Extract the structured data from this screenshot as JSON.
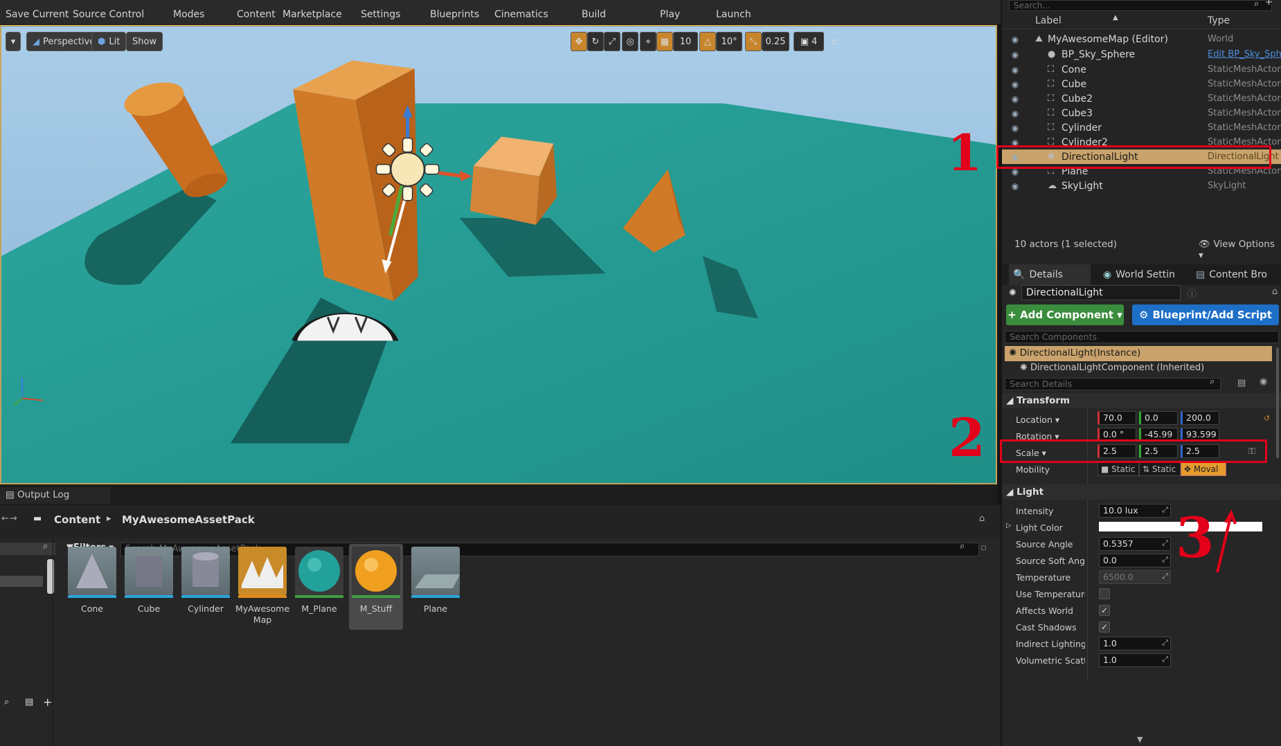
{
  "toolbar": {
    "items": [
      "Save Current",
      "Source Control",
      "Modes",
      "Content",
      "Marketplace",
      "Settings",
      "Blueprints",
      "Cinematics",
      "Build",
      "Play",
      "Launch"
    ]
  },
  "viewport": {
    "perspective_label": "Perspective",
    "lit_label": "Lit",
    "show_label": "Show",
    "grid_snap": "10",
    "rot_snap": "10°",
    "scale_snap": "0.25",
    "cam_speed": "4"
  },
  "outliner": {
    "search_placeholder": "Search...",
    "col_label": "Label",
    "col_type": "Type",
    "rows": [
      {
        "label": "MyAwesomeMap (Editor)",
        "type": "World"
      },
      {
        "label": "BP_Sky_Sphere",
        "type": "Edit BP_Sky_Sphere"
      },
      {
        "label": "Cone",
        "type": "StaticMeshActor"
      },
      {
        "label": "Cube",
        "type": "StaticMeshActor"
      },
      {
        "label": "Cube2",
        "type": "StaticMeshActor"
      },
      {
        "label": "Cube3",
        "type": "StaticMeshActor"
      },
      {
        "label": "Cylinder",
        "type": "StaticMeshActor"
      },
      {
        "label": "Cylinder2",
        "type": "StaticMeshActor"
      },
      {
        "label": "DirectionalLight",
        "type": "DirectionalLight"
      },
      {
        "label": "Plane",
        "type": "StaticMeshActor"
      },
      {
        "label": "SkyLight",
        "type": "SkyLight"
      }
    ],
    "status": "10 actors (1 selected)",
    "view_options": "View Options"
  },
  "details": {
    "tabs": [
      "Details",
      "World Settin",
      "Content Bro"
    ],
    "actor_name": "DirectionalLight",
    "add_component": "+ Add Component",
    "blueprint_script": "Blueprint/Add Script",
    "search_components_placeholder": "Search Components",
    "instance_label": "DirectionalLight(Instance)",
    "component_label": "DirectionalLightComponent (Inherited)",
    "search_details_placeholder": "Search Details",
    "transform_header": "Transform",
    "location_label": "Location",
    "location": [
      "70.0",
      "0.0",
      "200.0"
    ],
    "rotation_label": "Rotation",
    "rotation": [
      "0.0 °",
      "-45.99",
      "93.599"
    ],
    "scale_label": "Scale",
    "scale": [
      "2.5",
      "2.5",
      "2.5"
    ],
    "mobility_label": "Mobility",
    "mobility_options": [
      "Static",
      "Static",
      "Moval"
    ],
    "light_header": "Light",
    "light_props": [
      {
        "label": "Intensity",
        "value": "10.0 lux"
      },
      {
        "label": "Light Color",
        "value": ""
      },
      {
        "label": "Source Angle",
        "value": "0.5357"
      },
      {
        "label": "Source Soft Angle",
        "value": "0.0"
      },
      {
        "label": "Temperature",
        "value": "6500.0"
      },
      {
        "label": "Use Temperature",
        "value": ""
      },
      {
        "label": "Affects World",
        "value": ""
      },
      {
        "label": "Cast Shadows",
        "value": ""
      },
      {
        "label": "Indirect Lighting Inte",
        "value": "1.0"
      },
      {
        "label": "Volumetric Scatterii",
        "value": "1.0"
      }
    ]
  },
  "output_log": {
    "tab": "Output Log"
  },
  "content_browser": {
    "path_root": "Content",
    "path_folder": "MyAwesomeAssetPack",
    "filters": "Filters",
    "search_placeholder": "Search MyAwesomeAssetPack",
    "assets": [
      "Cone",
      "Cube",
      "Cylinder",
      "MyAwesome Map",
      "M_Plane",
      "M_Stuff",
      "Plane"
    ]
  },
  "annotations": [
    "1",
    "2",
    "3"
  ],
  "colors": {
    "accent_selection": "#c9a36b",
    "highlight_red": "#e2001a",
    "floor": "#2aa39a",
    "object_orange": "#d9822b"
  }
}
